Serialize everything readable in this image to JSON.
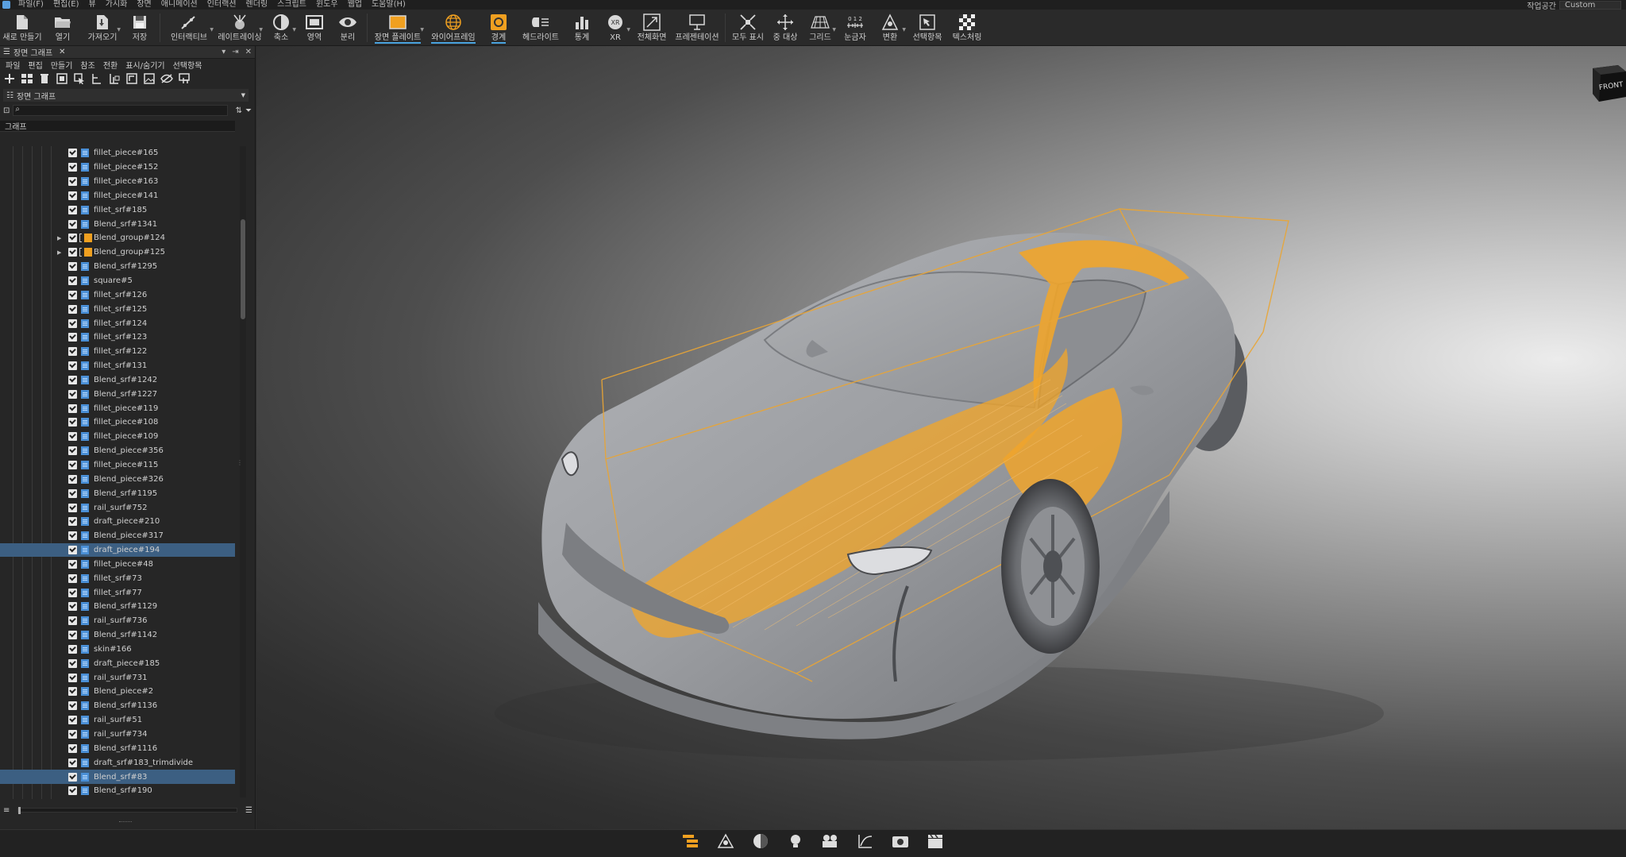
{
  "menubar": {
    "items": [
      "파일(F)",
      "편집(E)",
      "뷰",
      "가시화",
      "장면",
      "애니메이션",
      "인터랙션",
      "렌더링",
      "스크립트",
      "윈도우",
      "웹업",
      "도움말(H)"
    ],
    "workspace_label": "작업공간",
    "workspace_value": "Custom"
  },
  "toolbar": {
    "buttons": [
      {
        "label": "새로 만들기",
        "icon": "new-file-icon"
      },
      {
        "label": "열기",
        "icon": "open-folder-icon"
      },
      {
        "label": "가져오기",
        "icon": "import-icon"
      },
      {
        "label": "저장",
        "icon": "save-icon"
      },
      {
        "label": "인터랙티브",
        "icon": "interactive-icon"
      },
      {
        "label": "레이트레이싱",
        "icon": "raytracing-icon"
      },
      {
        "label": "축소",
        "icon": "reduce-icon"
      },
      {
        "label": "영역",
        "icon": "region-icon"
      },
      {
        "label": "분리",
        "icon": "separate-icon"
      },
      {
        "label": "장면 플레이트",
        "icon": "scene-plate-icon"
      },
      {
        "label": "와이어프레임",
        "icon": "wireframe-icon"
      },
      {
        "label": "경계",
        "icon": "boundary-icon"
      },
      {
        "label": "헤드라이트",
        "icon": "headlight-icon"
      },
      {
        "label": "통계",
        "icon": "statistics-icon"
      },
      {
        "label": "XR",
        "icon": "xr-icon"
      },
      {
        "label": "전체화면",
        "icon": "fullscreen-icon"
      },
      {
        "label": "프레젠테이션",
        "icon": "presentation-icon"
      },
      {
        "label": "모두 표시",
        "icon": "show-all-icon"
      },
      {
        "label": "중 대상",
        "icon": "center-target-icon"
      },
      {
        "label": "그리드",
        "icon": "grid-icon"
      },
      {
        "label": "눈금자",
        "icon": "ruler-icon"
      },
      {
        "label": "변환",
        "icon": "transform-icon"
      },
      {
        "label": "선택항목",
        "icon": "selection-icon"
      },
      {
        "label": "텍스처링",
        "icon": "texturing-icon"
      }
    ]
  },
  "panel": {
    "title": "장면 그래프",
    "menu": [
      "파일",
      "편집",
      "만들기",
      "참조",
      "전환",
      "표시/숨기기",
      "선택항목"
    ],
    "view_select": "장면 그래프",
    "search_placeholder": "",
    "graph_header": "그래프",
    "tree": [
      {
        "name": "fillet_piece#165",
        "type": "surf"
      },
      {
        "name": "fillet_piece#152",
        "type": "surf"
      },
      {
        "name": "fillet_piece#163",
        "type": "surf"
      },
      {
        "name": "fillet_piece#141",
        "type": "surf"
      },
      {
        "name": "fillet_srf#185",
        "type": "surf"
      },
      {
        "name": "Blend_srf#1341",
        "type": "surf"
      },
      {
        "name": "Blend_group#124",
        "type": "group"
      },
      {
        "name": "Blend_group#125",
        "type": "group"
      },
      {
        "name": "Blend_srf#1295",
        "type": "surf"
      },
      {
        "name": "square#5",
        "type": "surf"
      },
      {
        "name": "fillet_srf#126",
        "type": "surf"
      },
      {
        "name": "fillet_srf#125",
        "type": "surf"
      },
      {
        "name": "fillet_srf#124",
        "type": "surf"
      },
      {
        "name": "fillet_srf#123",
        "type": "surf"
      },
      {
        "name": "fillet_srf#122",
        "type": "surf"
      },
      {
        "name": "fillet_srf#131",
        "type": "surf"
      },
      {
        "name": "Blend_srf#1242",
        "type": "surf"
      },
      {
        "name": "Blend_srf#1227",
        "type": "surf"
      },
      {
        "name": "fillet_piece#119",
        "type": "surf"
      },
      {
        "name": "fillet_piece#108",
        "type": "surf"
      },
      {
        "name": "fillet_piece#109",
        "type": "surf"
      },
      {
        "name": "Blend_piece#356",
        "type": "surf"
      },
      {
        "name": "fillet_piece#115",
        "type": "surf"
      },
      {
        "name": "Blend_piece#326",
        "type": "surf"
      },
      {
        "name": "Blend_srf#1195",
        "type": "surf"
      },
      {
        "name": "rail_surf#752",
        "type": "surf"
      },
      {
        "name": "draft_piece#210",
        "type": "surf"
      },
      {
        "name": "Blend_piece#317",
        "type": "surf"
      },
      {
        "name": "draft_piece#194",
        "type": "surf",
        "selected": true
      },
      {
        "name": "fillet_piece#48",
        "type": "surf"
      },
      {
        "name": "fillet_srf#73",
        "type": "surf"
      },
      {
        "name": "fillet_srf#77",
        "type": "surf"
      },
      {
        "name": "Blend_srf#1129",
        "type": "surf"
      },
      {
        "name": "rail_surf#736",
        "type": "surf"
      },
      {
        "name": "Blend_srf#1142",
        "type": "surf"
      },
      {
        "name": "skin#166",
        "type": "surf"
      },
      {
        "name": "draft_piece#185",
        "type": "surf"
      },
      {
        "name": "rail_surf#731",
        "type": "surf"
      },
      {
        "name": "Blend_piece#2",
        "type": "surf"
      },
      {
        "name": "Blend_srf#1136",
        "type": "surf"
      },
      {
        "name": "rail_surf#51",
        "type": "surf"
      },
      {
        "name": "rail_surf#734",
        "type": "surf"
      },
      {
        "name": "Blend_srf#1116",
        "type": "surf"
      },
      {
        "name": "draft_srf#183_trimdivide",
        "type": "surf"
      },
      {
        "name": "Blend_srf#83",
        "type": "surf",
        "selected": true
      },
      {
        "name": "Blend_srf#190",
        "type": "surf"
      }
    ]
  },
  "viewport": {
    "viewcube_label": "FRONT",
    "highlight_color": "#f0a52c",
    "body_color": "#9ea0a4"
  },
  "bottombar": {
    "buttons": [
      {
        "icon": "scene-graph-icon"
      },
      {
        "icon": "transform-tool-icon"
      },
      {
        "icon": "material-icon"
      },
      {
        "icon": "light-icon"
      },
      {
        "icon": "camera-icon"
      },
      {
        "icon": "curve-icon"
      },
      {
        "icon": "render-icon"
      },
      {
        "icon": "clapper-icon"
      }
    ]
  },
  "colors": {
    "accent": "#4aa3df",
    "selection": "#3c5f82",
    "orange": "#f0a020"
  }
}
